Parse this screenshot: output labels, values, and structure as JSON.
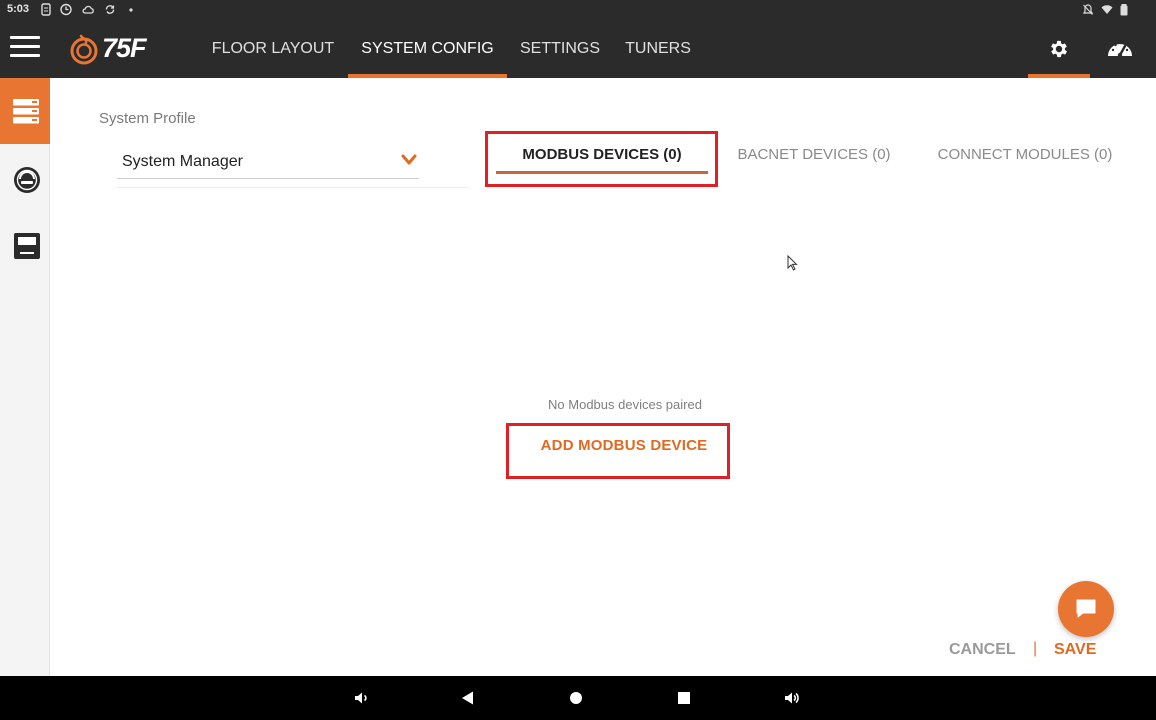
{
  "status_bar": {
    "time": "5:03"
  },
  "app_bar": {
    "brand": "75F",
    "nav": [
      {
        "label": "FLOOR LAYOUT",
        "active": false
      },
      {
        "label": "SYSTEM CONFIG",
        "active": true
      },
      {
        "label": "SETTINGS",
        "active": false
      },
      {
        "label": "TUNERS",
        "active": false
      }
    ],
    "icons": [
      "menu-icon",
      "gear-icon",
      "gauge-icon"
    ]
  },
  "side_rail": {
    "items": [
      {
        "icon": "system-config-icon",
        "active": true
      },
      {
        "icon": "dial-icon",
        "active": false
      },
      {
        "icon": "thermostat-icon",
        "active": false
      }
    ]
  },
  "system_profile": {
    "label": "System Profile",
    "selected": "System Manager"
  },
  "device_tabs": [
    {
      "label": "MODBUS DEVICES (0)",
      "active": true
    },
    {
      "label": "BACNET DEVICES (0)",
      "active": false
    },
    {
      "label": "CONNECT MODULES (0)",
      "active": false
    }
  ],
  "empty_state": {
    "message": "No Modbus devices paired",
    "action": "ADD MODBUS DEVICE"
  },
  "footer": {
    "cancel": "CANCEL",
    "separator": "|",
    "save": "SAVE"
  },
  "colors": {
    "accent": "#e87532",
    "app_bar": "#2b2b2b",
    "highlight_box": "#e02026"
  }
}
